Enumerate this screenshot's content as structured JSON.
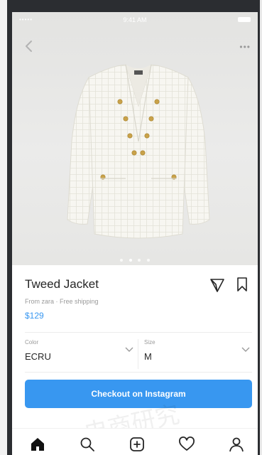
{
  "status_bar": {
    "signal": "•••••",
    "time": "9:41 AM"
  },
  "top_nav": {
    "back_icon": "chevron-left-icon",
    "more_icon": "more-dots-icon",
    "more_text": "•••"
  },
  "product": {
    "image": "white tweed jacket with gold buttons",
    "title": "Tweed Jacket",
    "subtitle": "From zara · Free shipping",
    "price": "$129",
    "carousel": {
      "count": 4,
      "active_index": 1
    }
  },
  "actions": {
    "share_icon": "direct-share-icon",
    "save_icon": "bookmark-icon"
  },
  "options": {
    "color": {
      "label": "Color",
      "value": "ECRU"
    },
    "size": {
      "label": "Size",
      "value": "M"
    }
  },
  "checkout_button": {
    "label": "Checkout on Instagram"
  },
  "watermark": "电商研究",
  "bottom_nav": [
    {
      "name": "home-icon",
      "active": true
    },
    {
      "name": "search-icon",
      "active": false
    },
    {
      "name": "add-post-icon",
      "active": false
    },
    {
      "name": "heart-icon",
      "active": false
    },
    {
      "name": "profile-icon",
      "active": false
    }
  ],
  "colors": {
    "accent": "#3897f0",
    "text": "#262626",
    "muted": "#9a9a9a",
    "hero_bg": "#e8e8e6"
  }
}
